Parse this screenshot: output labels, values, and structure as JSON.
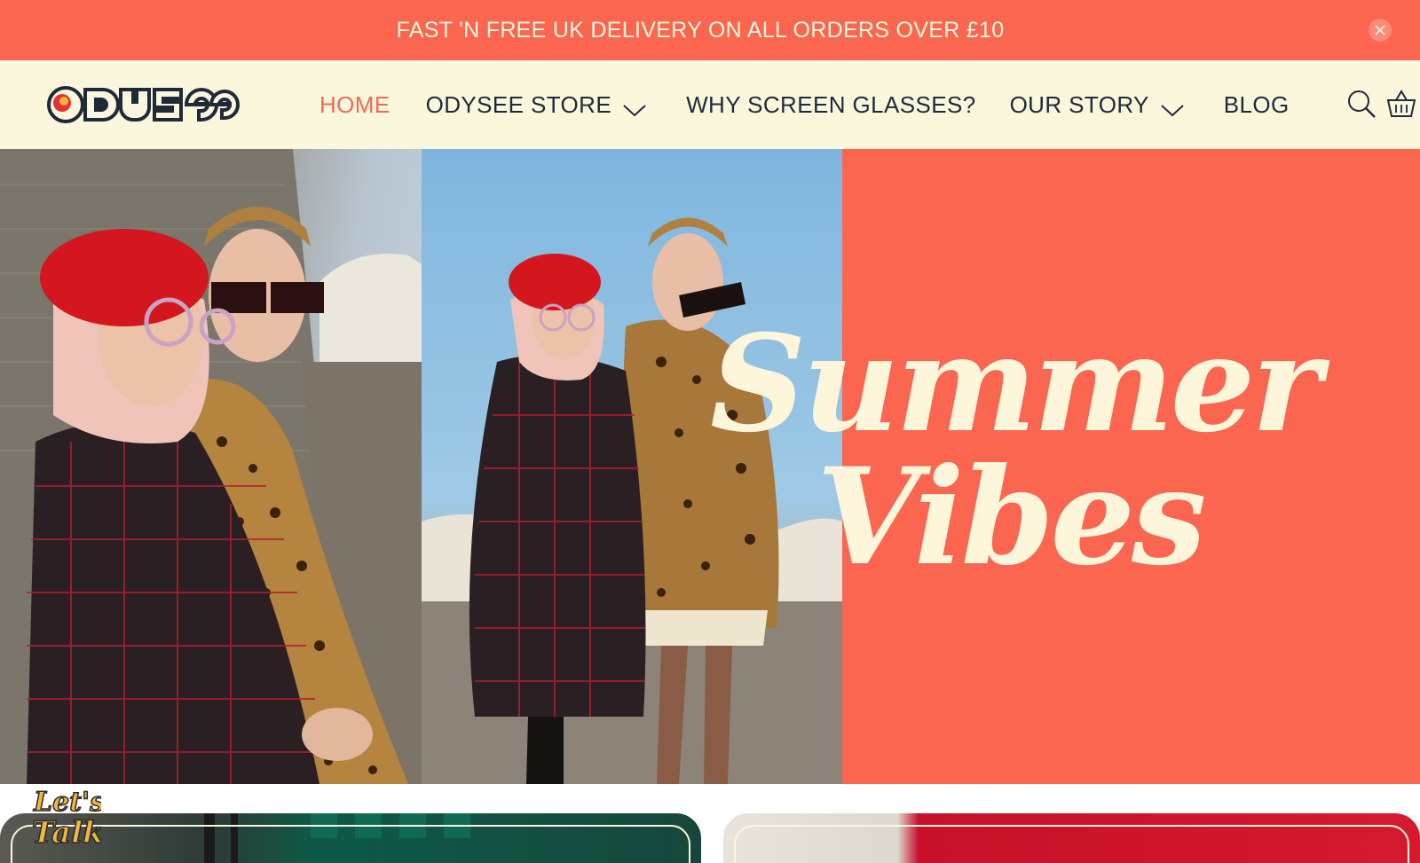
{
  "announcement": {
    "text": "FAST 'N FREE UK DELIVERY ON ALL ORDERS OVER £10",
    "close_icon": "close-icon"
  },
  "header": {
    "logo_text": "ODYSEE",
    "nav": [
      {
        "label": "HOME",
        "active": true
      },
      {
        "label": "ODYSEE STORE",
        "dropdown": true
      },
      {
        "label": "WHY SCREEN GLASSES?"
      },
      {
        "label": "OUR STORY",
        "dropdown": true
      },
      {
        "label": "BLOG"
      }
    ],
    "icons": [
      "search-icon",
      "basket-icon"
    ]
  },
  "hero": {
    "line1": "Summer",
    "line2": "Vibes"
  },
  "badge": {
    "line1": "Let's",
    "line2": "Talk"
  },
  "colors": {
    "brand_coral": "#fa6650",
    "cream": "#fdf6da",
    "header_bg": "#fbf7dc",
    "navy_text": "#1e2a3a",
    "active_nav": "#f06a55"
  }
}
